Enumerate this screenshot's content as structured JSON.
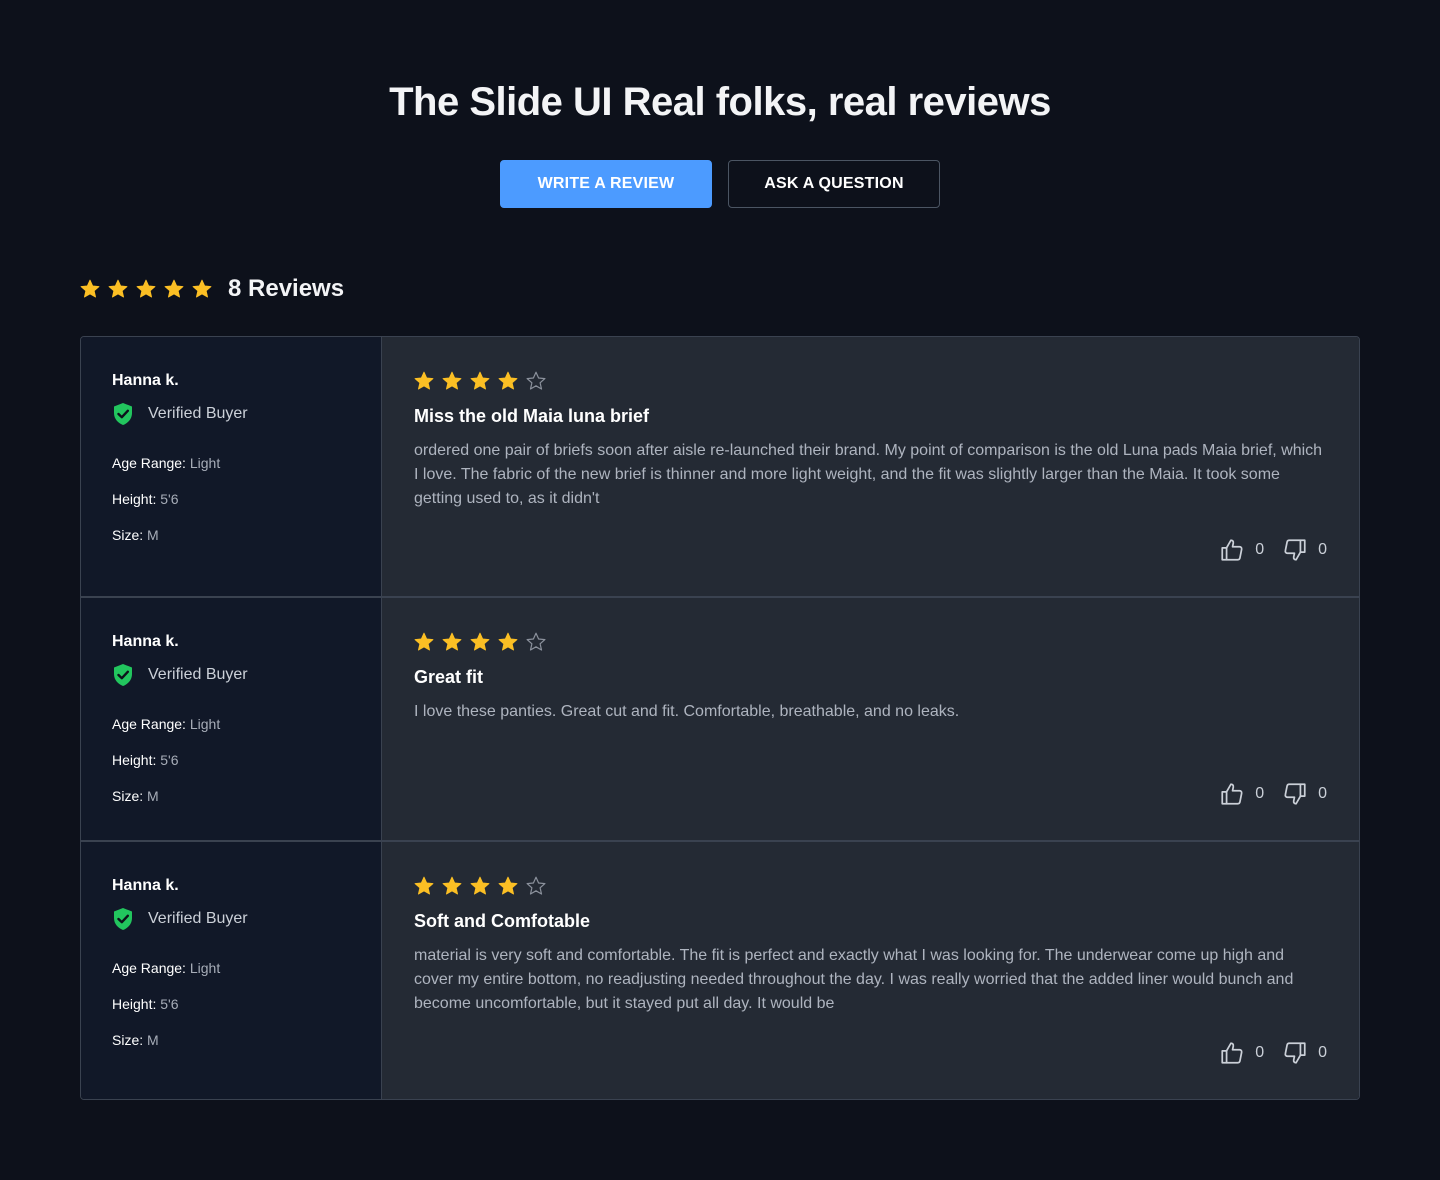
{
  "header": {
    "title": "The Slide UI Real folks, real reviews",
    "write_review_label": "WRITE A REVIEW",
    "ask_question_label": "ASK A QUESTION",
    "primary_color": "#4c9bff"
  },
  "summary": {
    "rating": 5,
    "reviews_label": "8 Reviews",
    "star_color": "#fbbf24"
  },
  "reviews": [
    {
      "name": "Hanna k.",
      "verified_label": "Verified Buyer",
      "age_label": "Age Range:",
      "age_value": "Light",
      "height_label": "Height:",
      "height_value": "5'6",
      "size_label": "Size:",
      "size_value": "M",
      "rating": 4,
      "title": "Miss the old Maia luna brief",
      "body": "ordered one pair of briefs soon after aisle re-launched their brand. My point of comparison is the old Luna pads Maia brief, which I love. The fabric of the new brief is thinner and more light weight, and the fit was slightly larger than the Maia. It took some getting used to, as it didn't",
      "likes": "0",
      "dislikes": "0"
    },
    {
      "name": "Hanna k.",
      "verified_label": "Verified Buyer",
      "age_label": "Age Range:",
      "age_value": "Light",
      "height_label": "Height:",
      "height_value": "5'6",
      "size_label": "Size:",
      "size_value": "M",
      "rating": 4,
      "title": "Great fit",
      "body": "I love these panties. Great cut and fit. Comfortable, breathable, and no leaks.",
      "likes": "0",
      "dislikes": "0"
    },
    {
      "name": "Hanna k.",
      "verified_label": "Verified Buyer",
      "age_label": "Age Range:",
      "age_value": "Light",
      "height_label": "Height:",
      "height_value": "5'6",
      "size_label": "Size:",
      "size_value": "M",
      "rating": 4,
      "title": "Soft and Comfotable",
      "body": "material is very soft and comfortable. The fit is perfect and exactly what I was looking for. The underwear come up high and cover my entire bottom, no readjusting needed throughout the day. I was really worried that the added liner would bunch and become uncomfortable, but it stayed put all day. It would be",
      "likes": "0",
      "dislikes": "0"
    }
  ]
}
